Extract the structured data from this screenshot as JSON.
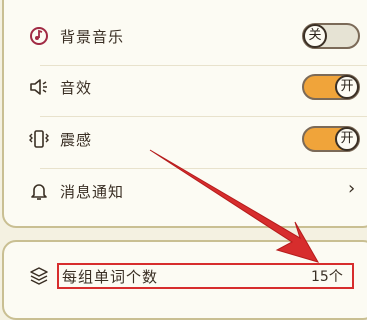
{
  "settings": {
    "items": [
      {
        "label": "背景音乐",
        "icon": "music-note-icon",
        "toggle": "关",
        "on": false
      },
      {
        "label": "音效",
        "icon": "speaker-icon",
        "toggle": "开",
        "on": true
      },
      {
        "label": "震感",
        "icon": "vibration-icon",
        "toggle": "开",
        "on": true
      },
      {
        "label": "消息通知",
        "icon": "bell-icon",
        "chevron": "›"
      }
    ]
  },
  "study": {
    "words_per_group_label": "每组单词个数",
    "words_per_group_value": "15个",
    "icon": "layers-icon"
  },
  "colors": {
    "background": "#f4f1e1",
    "card": "#fcfbf3",
    "card_border": "#c9bf92",
    "toggle_on": "#f0a43a",
    "highlight": "#d72d2d"
  }
}
